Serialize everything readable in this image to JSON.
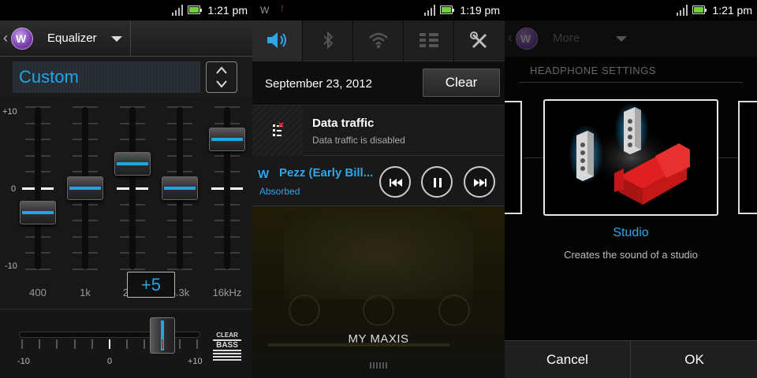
{
  "panels": {
    "equalizer": {
      "status_time": "1:21 pm",
      "header_title": "Equalizer",
      "preset": "Custom",
      "scale": {
        "top": "+10",
        "zero": "0",
        "bottom": "-10"
      },
      "bands": [
        {
          "label": "400",
          "level": -3
        },
        {
          "label": "1k",
          "level": 0
        },
        {
          "label": "2.5k",
          "level": 3
        },
        {
          "label": "6.3k",
          "level": 0
        },
        {
          "label": "16kHz",
          "level": 6
        }
      ],
      "value_popup": "+5",
      "clear_bass": {
        "min": "-10",
        "zero": "0",
        "max": "+10",
        "logo_top": "CLEAR",
        "logo_bottom": "BASS",
        "level": 6
      }
    },
    "notifications": {
      "status_time": "1:19 pm",
      "quick_settings": [
        {
          "name": "sound-icon",
          "active": true
        },
        {
          "name": "bluetooth-icon",
          "active": false
        },
        {
          "name": "wifi-icon",
          "active": false
        },
        {
          "name": "data-icon",
          "active": false
        },
        {
          "name": "settings-icon",
          "active": false
        }
      ],
      "date": "September 23, 2012",
      "clear_label": "Clear",
      "data_traffic": {
        "title": "Data traffic",
        "subtitle": "Data traffic is disabled"
      },
      "player": {
        "title": "Pezz (Early Bill...",
        "subtitle": "Absorbed"
      },
      "background_label": "MY MAXIS"
    },
    "headphones": {
      "status_time": "1:21 pm",
      "header_title": "More",
      "section": "HEADPHONE SETTINGS",
      "option_title": "Studio",
      "option_desc": "Creates the sound of a studio",
      "cancel_label": "Cancel",
      "ok_label": "OK"
    }
  },
  "colors": {
    "accent": "#1ba7e8",
    "active_icon": "#2fa6e8",
    "battery": "#6fd13c",
    "sofa": "#e02020"
  }
}
